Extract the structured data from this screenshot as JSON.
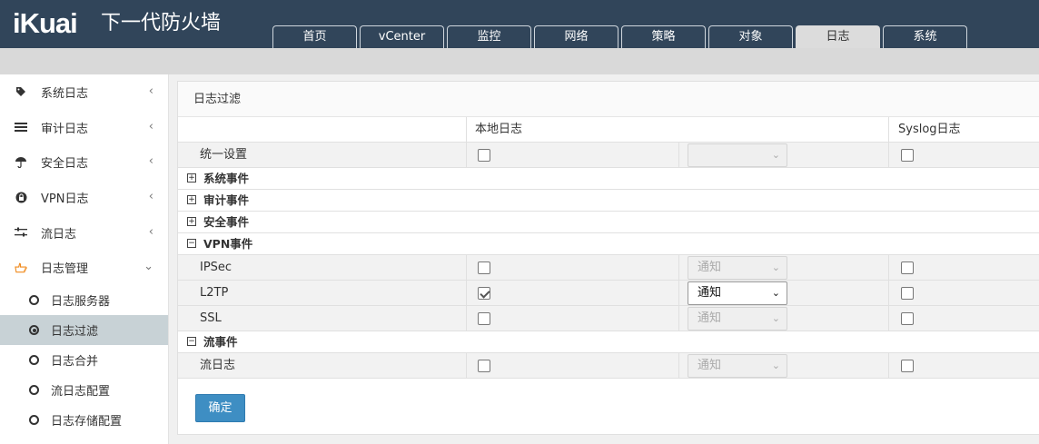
{
  "brand": {
    "logo": "iKuai",
    "product": "下一代防火墙"
  },
  "tabs": [
    "首页",
    "vCenter",
    "监控",
    "网络",
    "策略",
    "对象",
    "日志",
    "系统"
  ],
  "active_tab": "日志",
  "sidebar": {
    "items": [
      {
        "label": "系统日志",
        "icon": "tag-icon"
      },
      {
        "label": "审计日志",
        "icon": "list-icon"
      },
      {
        "label": "安全日志",
        "icon": "umbrella-icon"
      },
      {
        "label": "VPN日志",
        "icon": "lock-icon"
      },
      {
        "label": "流日志",
        "icon": "sliders-icon"
      },
      {
        "label": "日志管理",
        "icon": "hand-pointer-icon"
      }
    ],
    "subitems": [
      "日志服务器",
      "日志过滤",
      "日志合并",
      "流日志配置",
      "日志存储配置"
    ],
    "active_sub": "日志过滤"
  },
  "panel": {
    "title": "日志过滤",
    "col_local": "本地日志",
    "col_syslog": "Syslog日志",
    "unified": {
      "label": "统一设置",
      "local_checked": false,
      "level": "",
      "syslog_checked": false
    },
    "groups_collapsed": [
      "系统事件",
      "审计事件",
      "安全事件"
    ],
    "vpn": {
      "label": "VPN事件",
      "rows": [
        {
          "label": "IPSec",
          "local_checked": false,
          "level": "通知",
          "enabled": false,
          "syslog_checked": false
        },
        {
          "label": "L2TP",
          "local_checked": true,
          "level": "通知",
          "enabled": true,
          "syslog_checked": false
        },
        {
          "label": "SSL",
          "local_checked": false,
          "level": "通知",
          "enabled": false,
          "syslog_checked": false
        }
      ]
    },
    "flow": {
      "label": "流事件",
      "rows": [
        {
          "label": "流日志",
          "local_checked": false,
          "level": "通知",
          "enabled": false,
          "syslog_checked": false
        }
      ]
    },
    "submit": "确定"
  },
  "colors": {
    "topbar": "#31455a",
    "accent": "#3e8ec3",
    "active_icon": "#f08a1c"
  }
}
